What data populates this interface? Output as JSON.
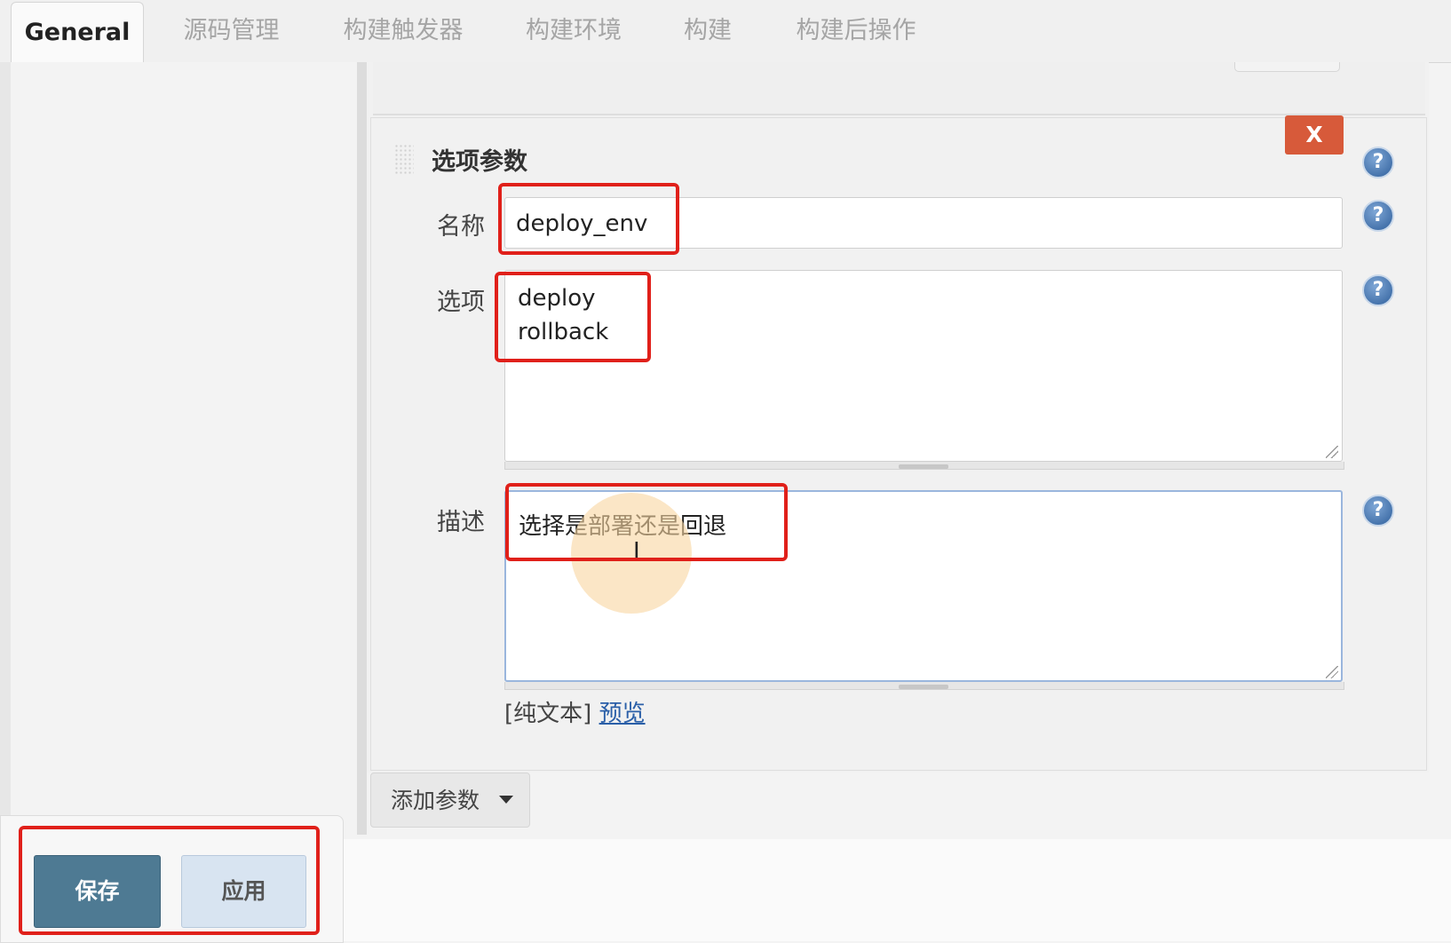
{
  "tabs": [
    {
      "label": "General",
      "active": true
    },
    {
      "label": "源码管理",
      "active": false
    },
    {
      "label": "构建触发器",
      "active": false
    },
    {
      "label": "构建环境",
      "active": false
    },
    {
      "label": "构建",
      "active": false
    },
    {
      "label": "构建后操作",
      "active": false
    }
  ],
  "param": {
    "title": "选项参数",
    "delete_label": "X",
    "name_label": "名称",
    "name_value": "deploy_env",
    "choices_label": "选项",
    "choices_lines": [
      "deploy",
      "rollback"
    ],
    "desc_label": "描述",
    "desc_value": "选择是部署还是回退",
    "format_plain": "[纯文本]",
    "format_preview": "预览"
  },
  "add_param_label": "添加参数",
  "help_glyph": "?",
  "cursor_glyph": "I",
  "buttons": {
    "save": "保存",
    "apply": "应用"
  },
  "colors": {
    "highlight": "#e0201a",
    "delete_button": "#d75a3a",
    "save_button": "#4e7a93",
    "apply_button": "#d8e4f1",
    "link": "#2a5fa8"
  }
}
